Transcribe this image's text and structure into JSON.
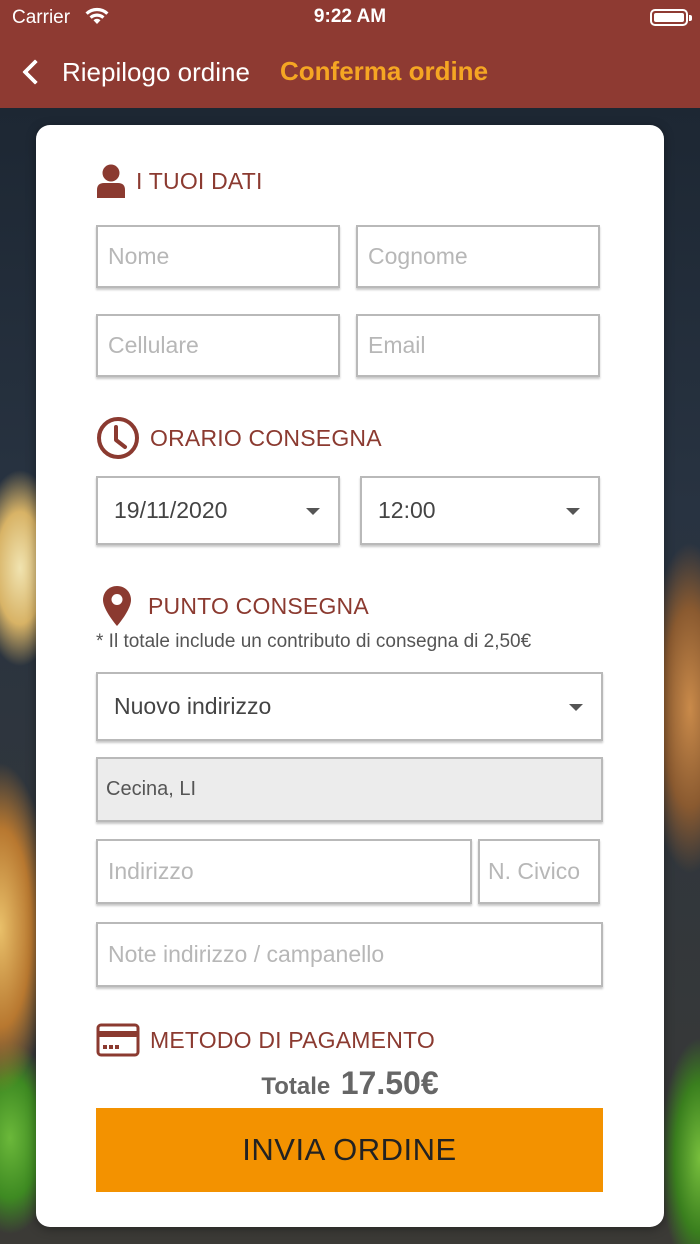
{
  "status_bar": {
    "carrier": "Carrier",
    "time": "9:22 AM"
  },
  "nav": {
    "back_label": "Riepilogo ordine",
    "title": "Conferma ordine"
  },
  "colors": {
    "brand": "#8e3a32",
    "accent": "#f5a623",
    "button": "#f39200",
    "section_heading": "#8b3a30"
  },
  "personal": {
    "heading": "I TUOI DATI",
    "icon": "user-icon",
    "first_name_placeholder": "Nome",
    "last_name_placeholder": "Cognome",
    "phone_placeholder": "Cellulare",
    "email_placeholder": "Email"
  },
  "delivery_time": {
    "heading": "ORARIO CONSEGNA",
    "icon": "clock-icon",
    "date": "19/11/2020",
    "time": "12:00"
  },
  "delivery_point": {
    "heading": "PUNTO CONSEGNA",
    "icon": "map-pin-icon",
    "note": "* Il totale include un contributo di consegna di 2,50€",
    "address_select": "Nuovo indirizzo",
    "city": "Cecina, LI",
    "street_placeholder": "Indirizzo",
    "number_placeholder": "N. Civico",
    "notes_placeholder": "Note indirizzo / campanello"
  },
  "payment": {
    "heading": "METODO DI PAGAMENTO",
    "icon": "credit-card-icon"
  },
  "summary": {
    "total_label": "Totale",
    "total_value": "17.50€"
  },
  "submit_label": "INVIA ORDINE"
}
